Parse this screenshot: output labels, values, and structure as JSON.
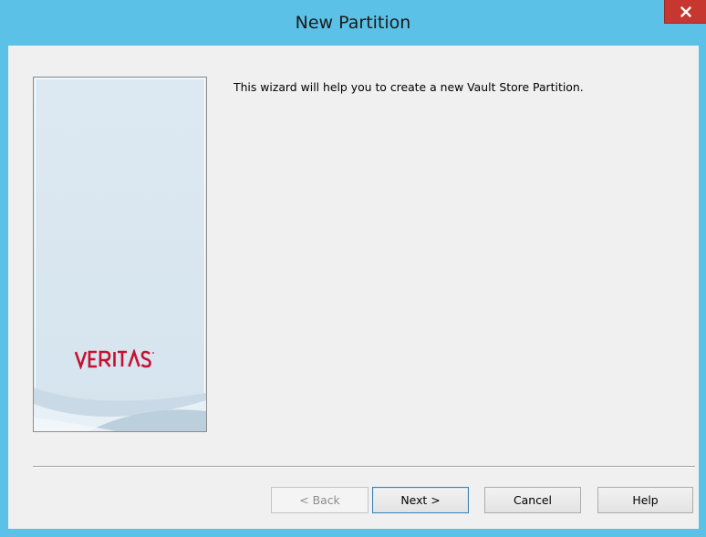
{
  "window": {
    "title": "New Partition",
    "close_icon": "close-icon"
  },
  "side_panel": {
    "logo_text": "VERITAS",
    "logo_color": "#c8102e"
  },
  "main": {
    "intro_text": "This wizard will help you to create a new Vault Store Partition."
  },
  "buttons": {
    "back_label": "< Back",
    "back_enabled": false,
    "next_label": "Next >",
    "cancel_label": "Cancel",
    "help_label": "Help"
  },
  "colors": {
    "titlebar": "#5bc1e7",
    "close_button": "#c7372f",
    "client_background": "#f0f0f0"
  }
}
